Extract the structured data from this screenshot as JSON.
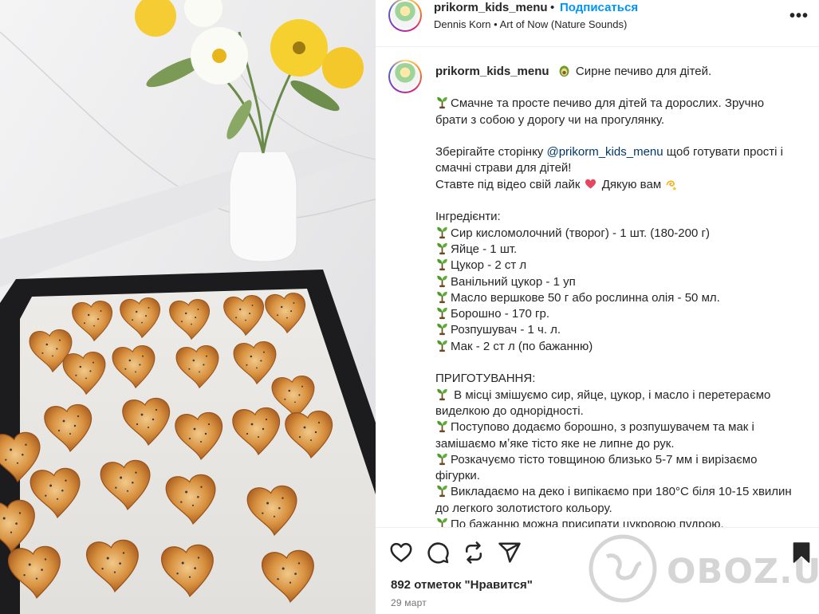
{
  "header": {
    "username": "prikorm_kids_menu",
    "separator": "•",
    "follow_label": "Подписаться",
    "audio": "Dennis Korn • Art of Now (Nature Sounds)",
    "more_label": "•••"
  },
  "caption": {
    "username": "prikorm_kids_menu",
    "title_icon": "avocado-emoji",
    "title": "Сирне печиво для дітей.",
    "intro": "Смачне та просте печиво для дітей та дорослих. Зручно брати з собою у дорогу чи на прогулянку.",
    "save_prefix": "Зберігайте сторінку ",
    "save_mention": "@prikorm_kids_menu",
    "save_suffix": " щоб готувати прості і смачні страви для дітей!",
    "like_prefix": "Ставте під відео свій лайк",
    "like_suffix": "Дякую вам",
    "ingredients_title": "Інгредієнти:",
    "ingredients": [
      "Сир кисломолочний (творог) - 1 шт. (180-200 г)",
      "Яйце - 1 шт.",
      "Цукор - 2 ст л",
      "Ванільний цукор - 1 уп",
      "Масло вершкове 50 г або рослинна олія - 50 мл.",
      "Борошно - 170 гр.",
      "Розпушувач - 1 ч. л.",
      "Мак - 2 ст л (по бажанню)"
    ],
    "steps_title": "ПРИГОТУВАННЯ:",
    "steps": [
      " В місці змішуємо сир, яйце, цукор, і масло і перетераємо виделкою до однорідності.",
      "Поступово додаємо борошно, з розпушувачем та мак і замішаємо мʼяке тісто яке не липне до рук.",
      "Розкачуємо тісто товщиною близько 5-7 мм і вирізаємо фігурки.",
      "Викладаємо на деко і випікаємо при 180°C біля 10-15 хвилин до легкого золотистого кольору.",
      "По бажанню можна присипати цукровою пудрою."
    ]
  },
  "actions": {
    "like_icon": "heart-icon",
    "comment_icon": "comment-icon",
    "repost_icon": "repost-icon",
    "share_icon": "share-icon",
    "save_icon": "bookmark-icon"
  },
  "likes": "892 отметок \"Нравится\"",
  "date": "29 март",
  "watermark": "OBOZ.UA",
  "colors": {
    "follow": "#0095f6",
    "mention": "#00376b",
    "text": "#262626",
    "muted": "#737373"
  }
}
